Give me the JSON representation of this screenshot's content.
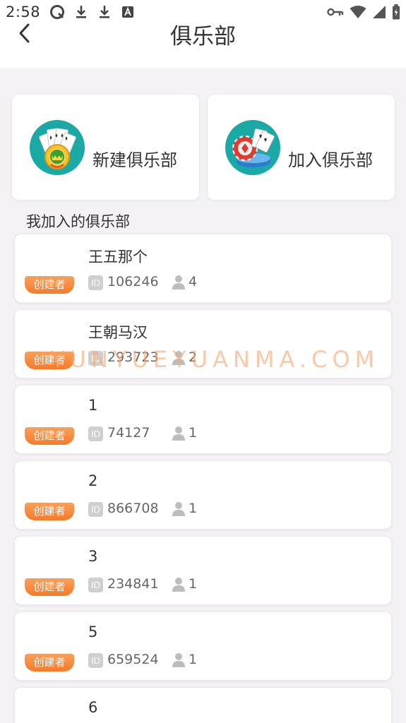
{
  "status_bar": {
    "time": "2:58"
  },
  "header": {
    "title": "俱乐部"
  },
  "actions": {
    "create_label": "新建俱乐部",
    "join_label": "加入俱乐部"
  },
  "section": {
    "title": "我加入的俱乐部"
  },
  "labels": {
    "creator": "创建者",
    "id_icon": "ID"
  },
  "clubs": [
    {
      "name": "王五那个",
      "id": "106246",
      "members": "4"
    },
    {
      "name": "王朝马汉",
      "id": "293723",
      "members": "2"
    },
    {
      "name": "1",
      "id": "74127",
      "members": "1"
    },
    {
      "name": "2",
      "id": "866708",
      "members": "1"
    },
    {
      "name": "3",
      "id": "234841",
      "members": "1"
    },
    {
      "name": "5",
      "id": "659524",
      "members": "1"
    },
    {
      "name": "6",
      "id": "",
      "members": ""
    }
  ],
  "watermark": "YUNYUEYUANMA.COM",
  "colors": {
    "accent_orange": "#f37b2b",
    "icon_teal": "#1aa9a5",
    "background": "#f5f2f5"
  }
}
